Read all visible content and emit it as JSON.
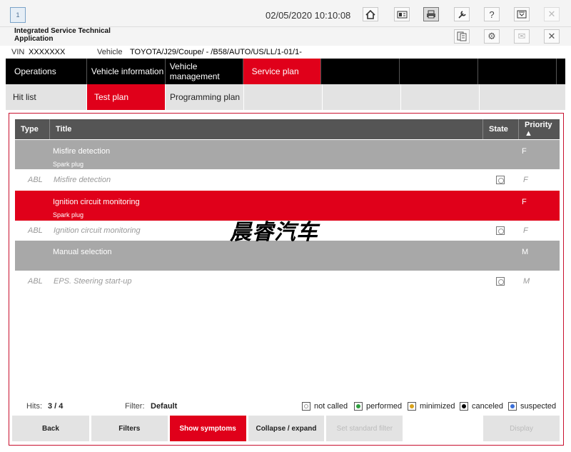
{
  "toolbar": {
    "app_icon_label": "1",
    "datetime": "02/05/2020 10:10:08",
    "icons": [
      "home-icon",
      "view-icon",
      "print-icon",
      "wrench-icon",
      "help-icon",
      "download-icon",
      "close-icon"
    ]
  },
  "app": {
    "title": "Integrated Service Technical Application"
  },
  "vehicle": {
    "vin_label": "VIN",
    "vin_value": "XXXXXXX",
    "vehicle_label": "Vehicle",
    "vehicle_value": "TOYOTA/J29/Coupe/ - /B58/AUTO/US/LL/1-01/1-"
  },
  "nav": {
    "items": [
      "Operations",
      "Vehicle information",
      "Vehicle management",
      "Service plan"
    ],
    "active": "Service plan"
  },
  "subnav": {
    "items": [
      "Hit list",
      "Test plan",
      "Programming plan"
    ],
    "active": "Test plan"
  },
  "table": {
    "headers": {
      "type": "Type",
      "title": "Title",
      "state": "State",
      "priority": "Priority ▲"
    },
    "rows": [
      {
        "kind": "group",
        "title": "Misfire detection",
        "subtitle": "Spark plug",
        "priority": "F"
      },
      {
        "kind": "abl",
        "type": "ABL",
        "title": "Misfire detection",
        "priority": "F"
      },
      {
        "kind": "group-red",
        "title": "Ignition circuit monitoring",
        "subtitle": "Spark plug",
        "priority": "F"
      },
      {
        "kind": "abl",
        "type": "ABL",
        "title": "Ignition circuit monitoring",
        "priority": "F"
      },
      {
        "kind": "group",
        "title": "Manual selection",
        "subtitle": "",
        "priority": "M"
      },
      {
        "kind": "abl",
        "type": "ABL",
        "title": "EPS. Steering start-up",
        "priority": "M"
      }
    ]
  },
  "status": {
    "hits_label": "Hits:",
    "hits_value": "3 / 4",
    "filter_label": "Filter:",
    "filter_value": "Default",
    "legend": [
      {
        "label": "not called",
        "color": "#ffffff"
      },
      {
        "label": "performed",
        "color": "#2e9e3e"
      },
      {
        "label": "minimized",
        "color": "#d9a21b"
      },
      {
        "label": "canceled",
        "color": "#000000"
      },
      {
        "label": "suspected",
        "color": "#3a6fd8"
      }
    ]
  },
  "buttons": {
    "back": "Back",
    "filters": "Filters",
    "show_symptoms": "Show symptoms",
    "collapse_expand": "Collapse / expand",
    "set_standard_filter": "Set standard filter",
    "display": "Display"
  },
  "watermark": "晨睿汽车",
  "colors": {
    "accent": "#e0001a",
    "nav_bg": "#000000",
    "group_row": "#a8a8a8"
  }
}
